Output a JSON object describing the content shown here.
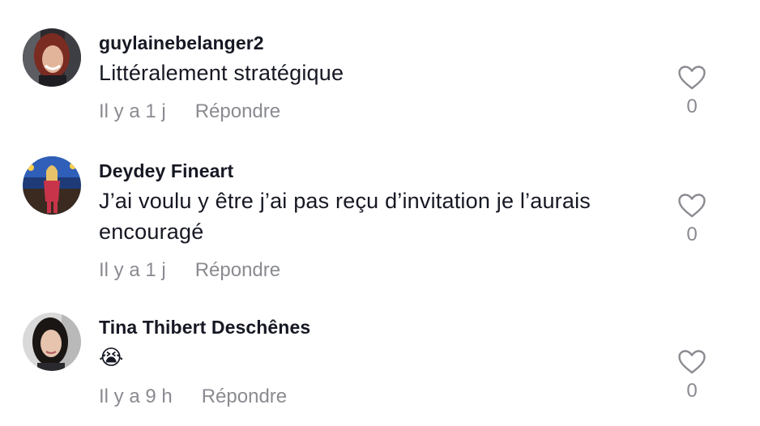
{
  "comments": [
    {
      "username": "guylainebelanger2",
      "text": "Littéralement stratégique",
      "time": "Il y a 1 j",
      "reply_label": "Répondre",
      "likes": "0"
    },
    {
      "username": "Deydey Fineart",
      "text": "J’ai voulu y être j’ai pas reçu d’invitation je l’aurais encouragé",
      "time": "Il y a 1 j",
      "reply_label": "Répondre",
      "likes": "0"
    },
    {
      "username": "Tina Thibert Deschênes",
      "text": "😭",
      "time": "Il y a 9 h",
      "reply_label": "Répondre",
      "likes": "0"
    }
  ],
  "icons": {
    "like": "heart-outline-icon"
  },
  "colors": {
    "text": "#161823",
    "secondary": "#8a8b91"
  }
}
